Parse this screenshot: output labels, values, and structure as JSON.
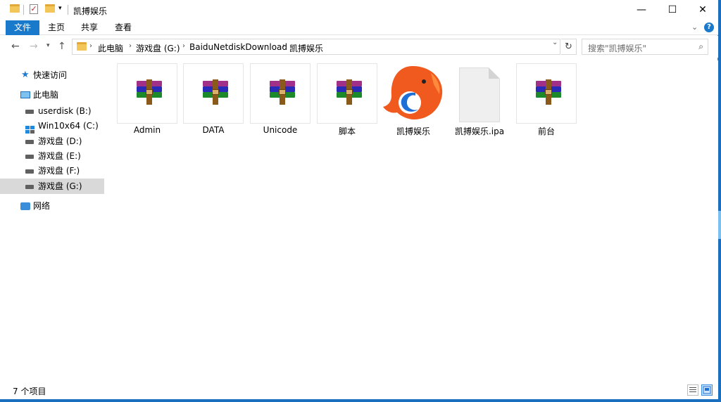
{
  "window": {
    "title": "凯搏娱乐",
    "controls": {
      "minimize": "—",
      "maximize": "☐",
      "close": "✕"
    }
  },
  "ribbon": {
    "tabs": [
      "文件",
      "主页",
      "共享",
      "查看"
    ],
    "help": "?"
  },
  "address": {
    "crumbs": [
      "此电脑",
      "游戏盘 (G:)",
      "BaiduNetdiskDownload",
      "凯搏娱乐"
    ],
    "search_placeholder": "搜索\"凯搏娱乐\""
  },
  "nav": {
    "quick_access": "快速访问",
    "this_pc": "此电脑",
    "drives": [
      "userdisk (B:)",
      "Win10x64 (C:)",
      "游戏盘 (D:)",
      "游戏盘 (E:)",
      "游戏盘 (F:)",
      "游戏盘 (G:)"
    ],
    "network": "网络"
  },
  "files": [
    {
      "name": "Admin",
      "icon": "winrar-archive-icon"
    },
    {
      "name": "DATA",
      "icon": "winrar-archive-icon"
    },
    {
      "name": "Unicode",
      "icon": "winrar-archive-icon"
    },
    {
      "name": "脚本",
      "icon": "winrar-archive-icon"
    },
    {
      "name": "凯搏娱乐",
      "icon": "app-logo-icon"
    },
    {
      "name": "凯搏娱乐.ipa",
      "icon": "blank-file-icon"
    },
    {
      "name": "前台",
      "icon": "winrar-archive-icon"
    }
  ],
  "status": {
    "count": "7 个项目"
  },
  "colors": {
    "accent": "#1979ca",
    "selection": "#d9d9d9",
    "logo_orange": "#f05a1e"
  }
}
